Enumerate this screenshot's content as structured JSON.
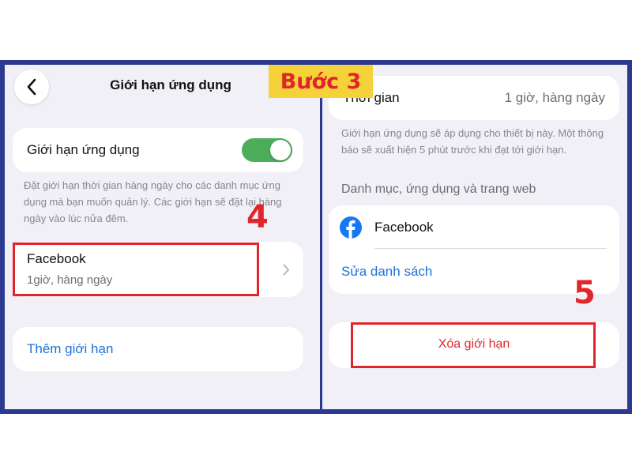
{
  "badge": {
    "step": "Bước 3"
  },
  "left": {
    "title": "Giới hạn ứng dụng",
    "toggle_row": {
      "label": "Giới hạn ứng dụng",
      "on": true
    },
    "description": "Đặt giới hạn thời gian hàng ngày cho các danh mục ứng dụng mà bạn muốn quản lý. Các giới hạn sẽ đặt lại hàng ngày vào lúc nửa đêm.",
    "limit_item": {
      "name": "Facebook",
      "detail": "1giờ, hàng ngày"
    },
    "add_limit": "Thêm giới hạn",
    "annotation": "4"
  },
  "right": {
    "time_row": {
      "label": "Thời gian",
      "value": "1 giờ, hàng ngày"
    },
    "description": "Giới hạn ứng dụng sẽ áp dụng cho thiết bị này. Một thông báo sẽ xuất hiện 5 phút trước khi đạt tới giới hạn.",
    "section_header": "Danh mục, ứng dụng và trang web",
    "app_item": "Facebook",
    "edit_list": "Sửa danh sách",
    "delete_limit": "Xóa giới hạn",
    "annotation": "5"
  },
  "colors": {
    "accent_blue": "#1f72d8",
    "toggle_green": "#4cae5b",
    "annotation_red": "#e0262b",
    "badge_yellow": "#f6d23a",
    "frame_border": "#2b3a8f"
  }
}
